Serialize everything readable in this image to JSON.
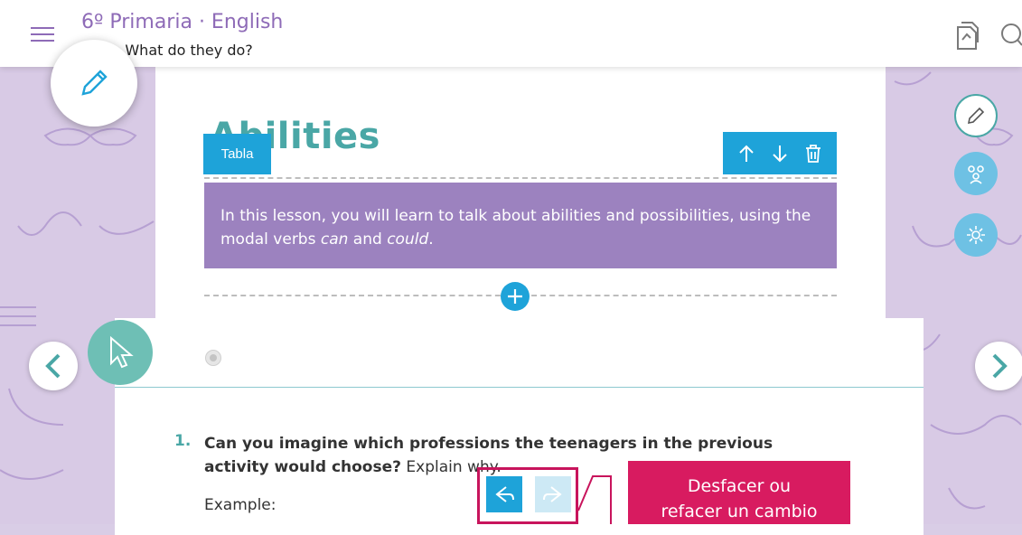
{
  "header": {
    "course_title": "6º Primaria · English",
    "unit_title": "5. What do they do?"
  },
  "page": {
    "heading": "Abilities",
    "block_tag": "Tabla",
    "lesson_intro_before": "In this lesson, you will learn to talk about abilities and possibilities, using the modal verbs ",
    "lesson_can": "can",
    "lesson_and": " and ",
    "lesson_could": "could",
    "lesson_end": ".",
    "question_number": "1.",
    "question_bold": "Can you imagine which professions the teenagers in the previous activity would choose?",
    "question_rest": " Explain why.",
    "example_label": "Example:"
  },
  "callout": {
    "line1": "Desfacer ou",
    "line2": "refacer un cambio"
  },
  "icons": {
    "menu": "hamburger-icon",
    "pages": "pages-icon",
    "search": "search-icon",
    "edit": "pencil-icon",
    "cursor": "cursor-icon",
    "prev": "chevron-left-icon",
    "next": "chevron-right-icon",
    "group": "group-icon",
    "settings": "gear-icon",
    "up": "arrow-up-icon",
    "down": "arrow-down-icon",
    "delete": "trash-icon",
    "add": "plus-icon",
    "undo": "undo-icon",
    "redo": "redo-icon"
  },
  "colors": {
    "accent_blue": "#1ea3d9",
    "brand_purple": "#8e6bb7",
    "lesson_box": "#9c82bf",
    "teal": "#4aa7a6",
    "callout_pink": "#d81b60"
  }
}
